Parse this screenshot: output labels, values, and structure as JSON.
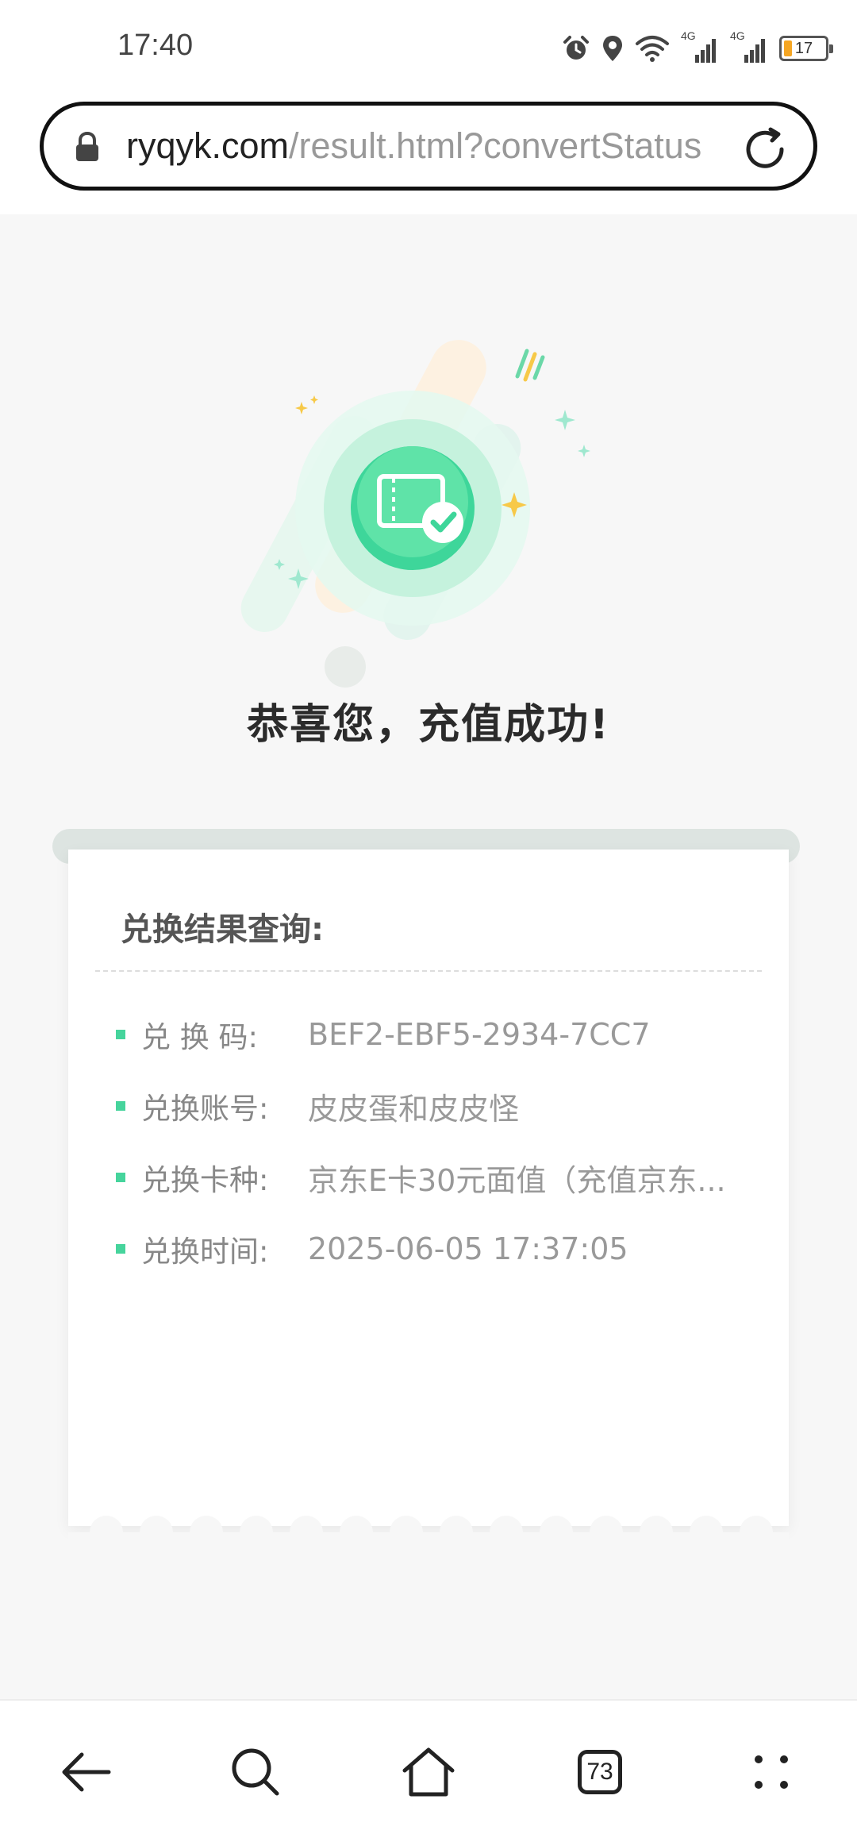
{
  "status_bar": {
    "time": "17:40",
    "battery_level": "17",
    "network_label_1": "4G",
    "network_label_2": "4G",
    "icons": [
      "alarm-icon",
      "location-icon",
      "wifi-icon",
      "signal-icon",
      "signal-icon",
      "battery-icon"
    ]
  },
  "browser": {
    "url_domain": "ryqyk.com",
    "url_path": "/result.html?convertStatus",
    "tab_count": "73"
  },
  "page": {
    "success_title": "恭喜您，充值成功!",
    "card_title": "兑换结果查询:",
    "rows": [
      {
        "label": "兑 换 码:",
        "value": "BEF2-EBF5-2934-7CC7"
      },
      {
        "label": "兑换账号:",
        "value": "皮皮蛋和皮皮怪"
      },
      {
        "label": "兑换卡种:",
        "value": "京东E卡30元面值（充值京东..."
      },
      {
        "label": "兑换时间:",
        "value": "2025-06-05 17:37:05"
      }
    ]
  },
  "colors": {
    "accent_green": "#46d49c",
    "battery_fill": "#f5a623",
    "sparkle_yellow": "#f7c948"
  }
}
